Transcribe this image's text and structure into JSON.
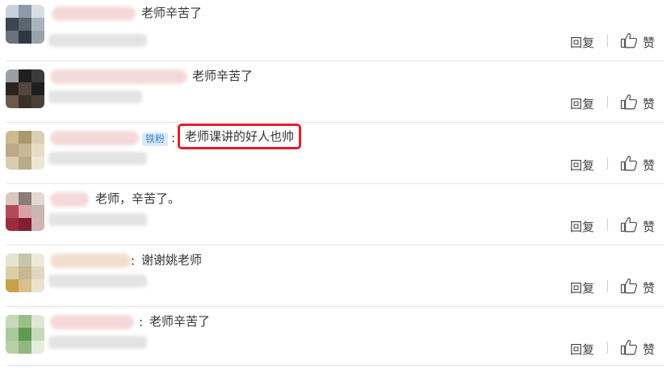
{
  "actions": {
    "reply_label": "回复",
    "like_label": "赞"
  },
  "comments": [
    {
      "text": "老师辛苦了"
    },
    {
      "text": "老师辛苦了"
    },
    {
      "badge": "铁粉",
      "text": "老师课讲的好人也帅"
    },
    {
      "text": "老师，辛苦了。"
    },
    {
      "text": "谢谢姚老师"
    },
    {
      "text": "老师辛苦了"
    }
  ],
  "colors": {
    "highlight_box": "#e0202a",
    "fan_badge_bg": "#dbe9fb",
    "fan_badge_text": "#3b82d6"
  }
}
